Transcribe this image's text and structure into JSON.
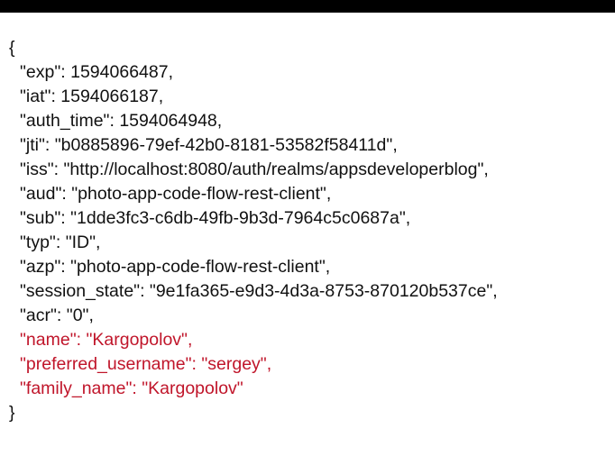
{
  "json": {
    "open_brace": "{",
    "close_brace": "}",
    "lines": [
      {
        "text": "\"exp\": 1594066487,",
        "highlight": false
      },
      {
        "text": "\"iat\": 1594066187,",
        "highlight": false
      },
      {
        "text": "\"auth_time\": 1594064948,",
        "highlight": false
      },
      {
        "text": "\"jti\": \"b0885896-79ef-42b0-8181-53582f58411d\",",
        "highlight": false
      },
      {
        "text": "\"iss\": \"http://localhost:8080/auth/realms/appsdeveloperblog\",",
        "highlight": false
      },
      {
        "text": "\"aud\": \"photo-app-code-flow-rest-client\",",
        "highlight": false
      },
      {
        "text": "\"sub\": \"1dde3fc3-c6db-49fb-9b3d-7964c5c0687a\",",
        "highlight": false
      },
      {
        "text": "\"typ\": \"ID\",",
        "highlight": false
      },
      {
        "text": "\"azp\": \"photo-app-code-flow-rest-client\",",
        "highlight": false
      },
      {
        "text": "\"session_state\": \"9e1fa365-e9d3-4d3a-8753-870120b537ce\",",
        "highlight": false
      },
      {
        "text": "\"acr\": \"0\",",
        "highlight": false
      },
      {
        "text": "\"name\": \"Kargopolov\",",
        "highlight": true
      },
      {
        "text": "\"preferred_username\": \"sergey\",",
        "highlight": true
      },
      {
        "text": "\"family_name\": \"Kargopolov\"",
        "highlight": true
      }
    ]
  },
  "colors": {
    "text": "#111111",
    "highlight": "#c0152a",
    "background": "#ffffff",
    "top_bar": "#000000"
  }
}
